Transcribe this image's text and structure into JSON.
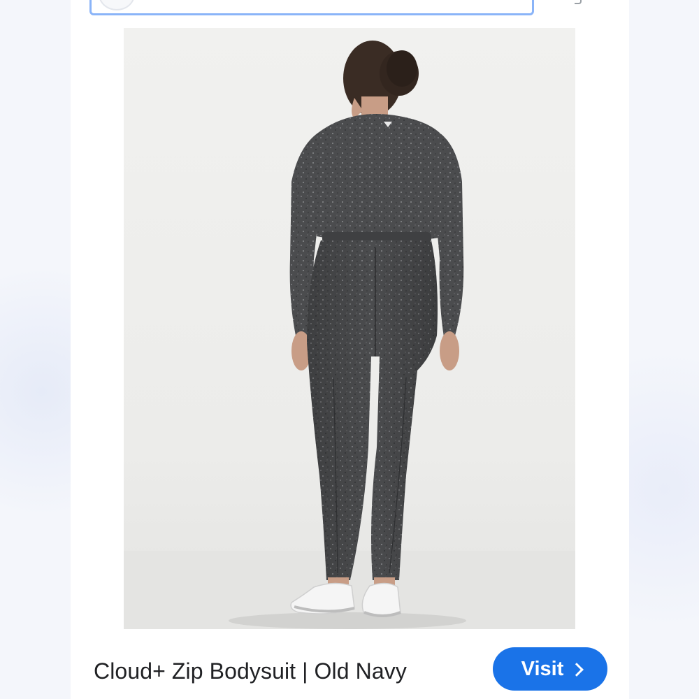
{
  "search": {
    "value": ""
  },
  "image": {
    "description_icon": "product-photo"
  },
  "result": {
    "title": "Cloud+ Zip Bodysuit | Old Navy",
    "visit_label": "Visit",
    "visit_icon": "chevron-right-icon"
  },
  "colors": {
    "accent": "#1a73e8",
    "search_border": "#8ab4f8",
    "text": "#202124"
  }
}
